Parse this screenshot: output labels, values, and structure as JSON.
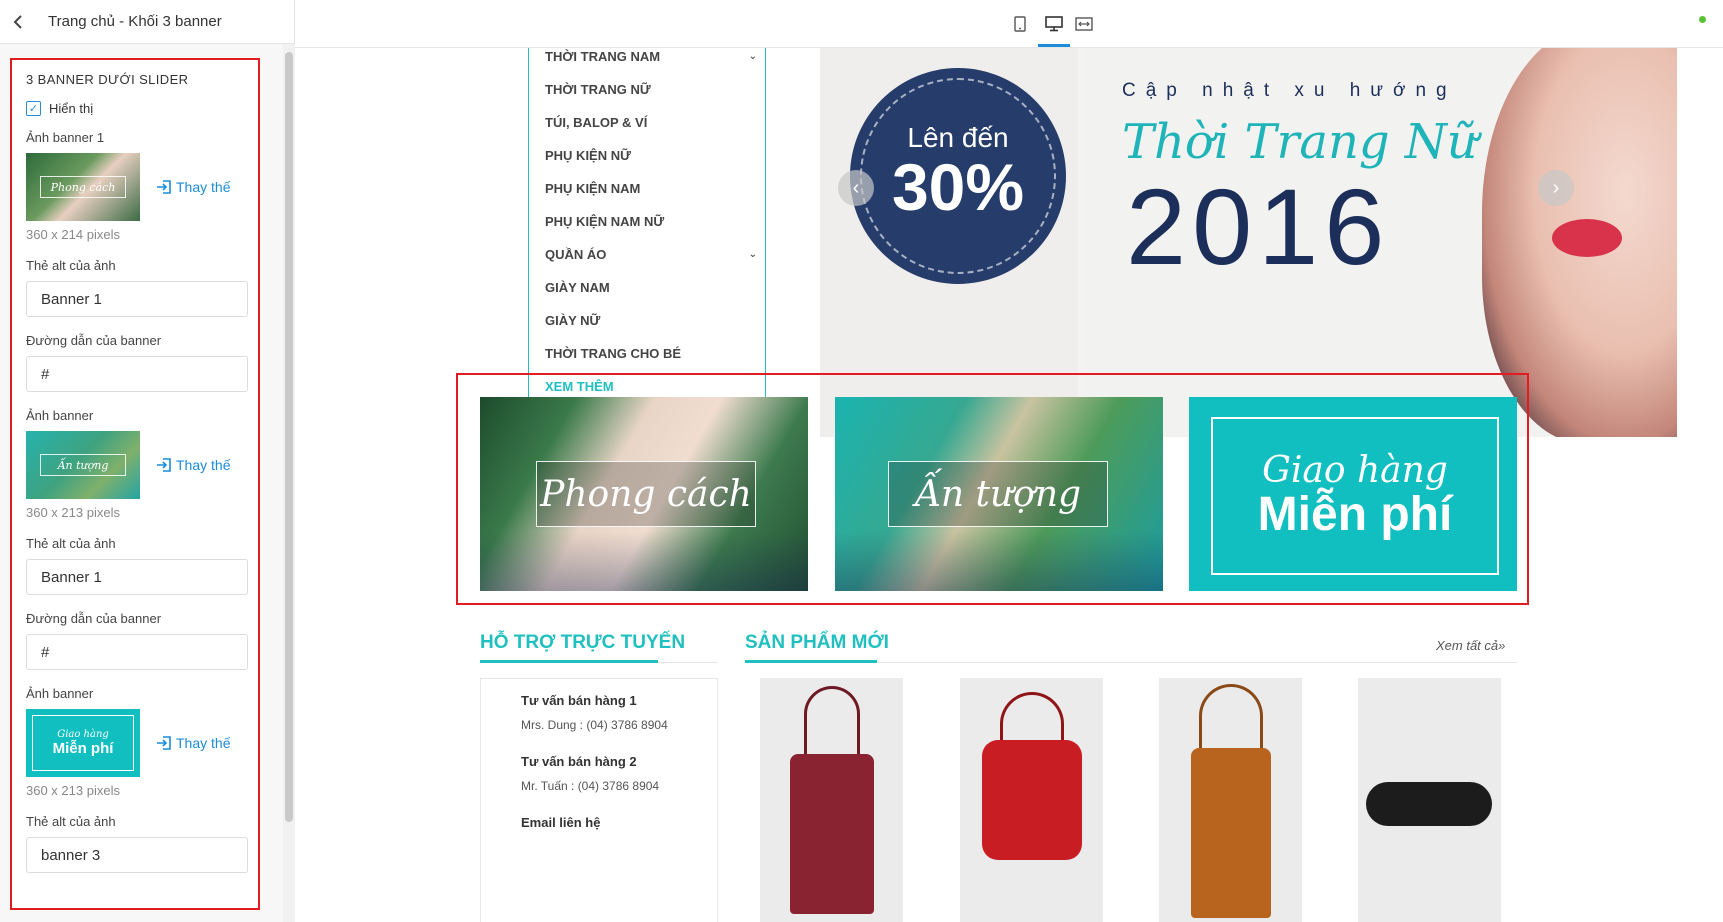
{
  "editor": {
    "header_title": "Trang chủ - Khối 3 banner",
    "section_title": "3 BANNER DƯỚI SLIDER",
    "show_label": "Hiển thị",
    "show_checked": true,
    "replace_label": "Thay thế",
    "banner1": {
      "image_label": "Ảnh banner 1",
      "thumb_text": "Phong cách",
      "dims": "360 x 214 pixels",
      "alt_label": "Thẻ alt của ảnh",
      "alt_value": "Banner 1",
      "link_label": "Đường dẫn của banner",
      "link_value": "#"
    },
    "banner2": {
      "image_label": "Ảnh banner",
      "thumb_text": "Ấn tượng",
      "dims": "360 x 213 pixels",
      "alt_label": "Thẻ alt của ảnh",
      "alt_value": "Banner 1",
      "link_label": "Đường dẫn của banner",
      "link_value": "#"
    },
    "banner3": {
      "image_label": "Ảnh banner",
      "thumb_line1": "Giao hàng",
      "thumb_line2": "Miễn phí",
      "dims": "360 x 213 pixels",
      "alt_label": "Thẻ alt của ảnh",
      "alt_value": "banner 3"
    }
  },
  "toolbar": {
    "views": [
      "mobile-icon",
      "desktop-icon",
      "fullwidth-icon"
    ],
    "active_view": "desktop-icon",
    "accent": "#1a8cd8"
  },
  "preview": {
    "menu": [
      {
        "label": "THỜI TRANG NAM",
        "has_sub": true
      },
      {
        "label": "THỜI TRANG NỮ",
        "has_sub": false
      },
      {
        "label": "TÚI, BALOP & VÍ",
        "has_sub": false
      },
      {
        "label": "PHỤ KIỆN NỮ",
        "has_sub": false
      },
      {
        "label": "PHỤ KIỆN NAM",
        "has_sub": false
      },
      {
        "label": "PHỤ KIỆN NAM NỮ",
        "has_sub": false
      },
      {
        "label": "QUẦN ÁO",
        "has_sub": true
      },
      {
        "label": "GIÀY NAM",
        "has_sub": false
      },
      {
        "label": "GIÀY NỮ",
        "has_sub": false
      },
      {
        "label": "THỜI TRANG CHO BÉ",
        "has_sub": false
      }
    ],
    "menu_more": "XEM THÊM",
    "slider": {
      "badge_top": "Lên đến",
      "badge_value": "30%",
      "kicker": "Cập nhật xu hướng",
      "script_title": "Thời Trang Nữ",
      "year": "2016",
      "prev_icon": "chevron-left-icon",
      "next_icon": "chevron-right-icon"
    },
    "banners": [
      {
        "text": "Phong cách"
      },
      {
        "text": "Ấn tượng"
      },
      {
        "line1": "Giao hàng",
        "line2": "Miễn phí"
      }
    ],
    "support_title": "HỖ TRỢ TRỰC TUYẾN",
    "new_products_title": "SẢN PHẨM MỚI",
    "see_all": "Xem tất cả»",
    "support": [
      {
        "name": "Tư vấn bán hàng 1",
        "contact": "Mrs. Dung : (04) 3786 8904"
      },
      {
        "name": "Tư vấn bán hàng 2",
        "contact": "Mr. Tuấn : (04) 3786 8904"
      },
      {
        "name": "Email liên hệ",
        "contact": ""
      }
    ],
    "brand_teal": "#21c0c0",
    "highlight_red": "#e31b23"
  }
}
